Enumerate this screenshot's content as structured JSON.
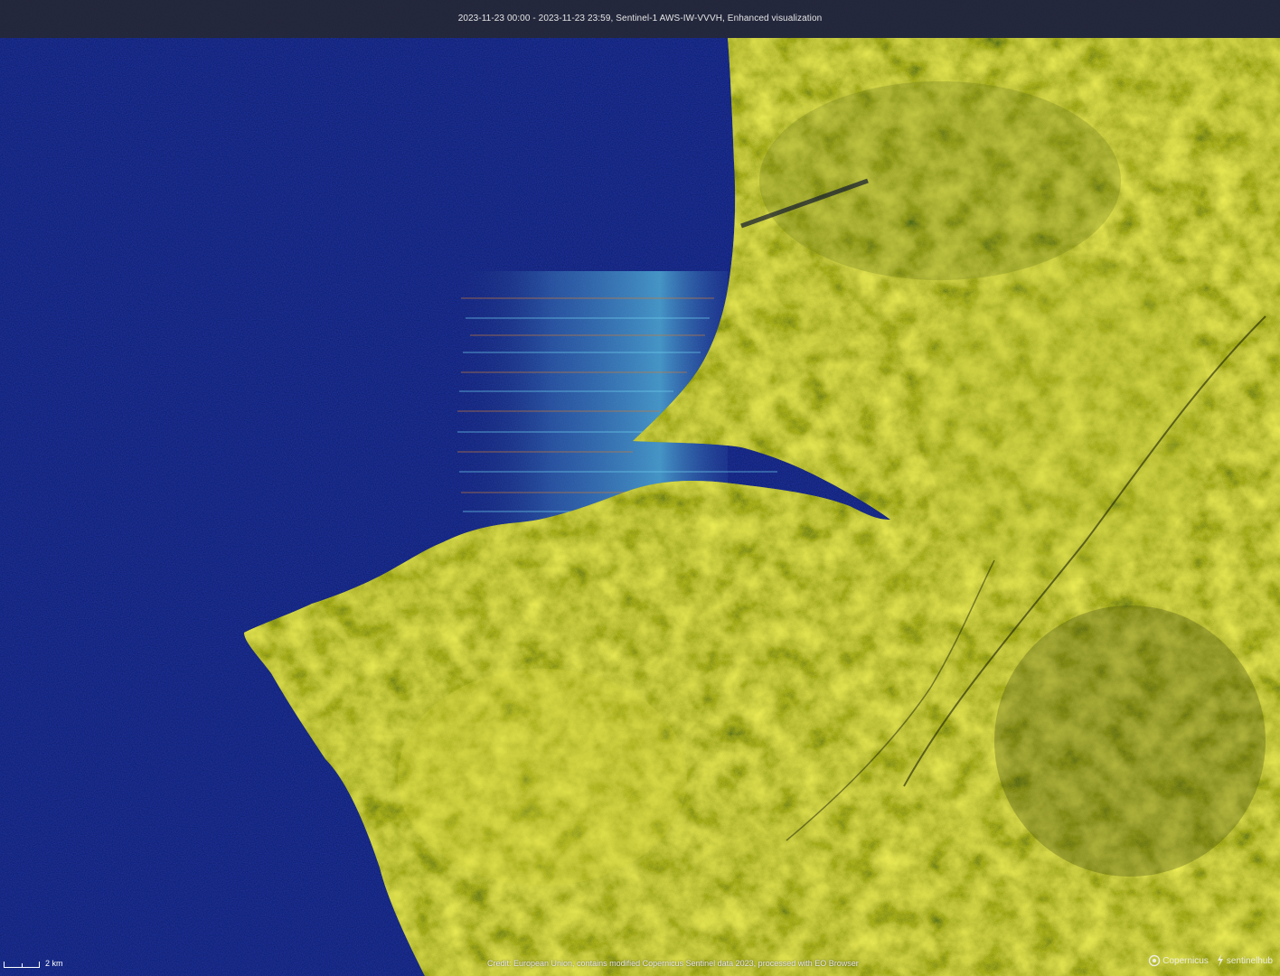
{
  "header": {
    "title": "2023-11-23 00:00 - 2023-11-23 23:59, Sentinel-1 AWS-IW-VVVH, Enhanced visualization"
  },
  "scale": {
    "label": "2 km"
  },
  "attribution": {
    "credit": "Credit: European Union, contains modified Copernicus Sentinel data 2023, processed with EO Browser"
  },
  "logos": {
    "copernicus": "Copernicus",
    "sentinelhub": "sentinelhub"
  },
  "colors": {
    "sea": "#0d1a66",
    "land_bright": "#c8c830",
    "land_dark": "#4a5a14",
    "wake": "#4fb0d8",
    "wake_orange": "#c77a3a"
  }
}
